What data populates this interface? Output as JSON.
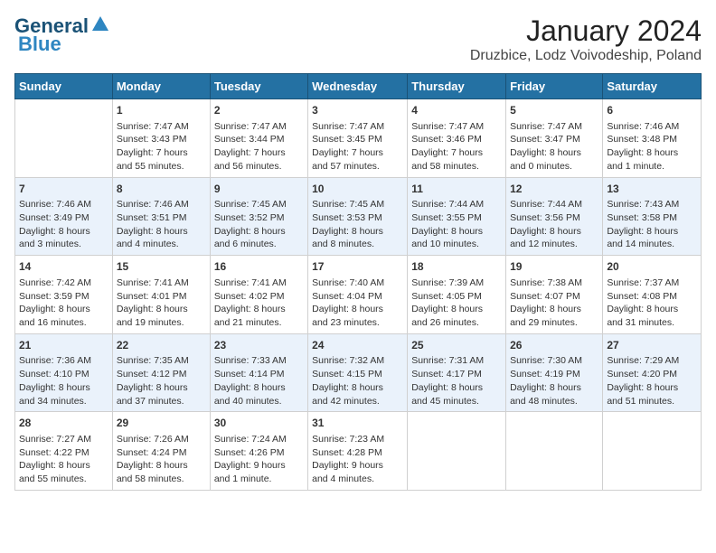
{
  "header": {
    "logo_line1": "General",
    "logo_line2": "Blue",
    "title": "January 2024",
    "subtitle": "Druzbice, Lodz Voivodeship, Poland"
  },
  "weekdays": [
    "Sunday",
    "Monday",
    "Tuesday",
    "Wednesday",
    "Thursday",
    "Friday",
    "Saturday"
  ],
  "weeks": [
    [
      {
        "day": "",
        "info": ""
      },
      {
        "day": "1",
        "info": "Sunrise: 7:47 AM\nSunset: 3:43 PM\nDaylight: 7 hours\nand 55 minutes."
      },
      {
        "day": "2",
        "info": "Sunrise: 7:47 AM\nSunset: 3:44 PM\nDaylight: 7 hours\nand 56 minutes."
      },
      {
        "day": "3",
        "info": "Sunrise: 7:47 AM\nSunset: 3:45 PM\nDaylight: 7 hours\nand 57 minutes."
      },
      {
        "day": "4",
        "info": "Sunrise: 7:47 AM\nSunset: 3:46 PM\nDaylight: 7 hours\nand 58 minutes."
      },
      {
        "day": "5",
        "info": "Sunrise: 7:47 AM\nSunset: 3:47 PM\nDaylight: 8 hours\nand 0 minutes."
      },
      {
        "day": "6",
        "info": "Sunrise: 7:46 AM\nSunset: 3:48 PM\nDaylight: 8 hours\nand 1 minute."
      }
    ],
    [
      {
        "day": "7",
        "info": "Sunrise: 7:46 AM\nSunset: 3:49 PM\nDaylight: 8 hours\nand 3 minutes."
      },
      {
        "day": "8",
        "info": "Sunrise: 7:46 AM\nSunset: 3:51 PM\nDaylight: 8 hours\nand 4 minutes."
      },
      {
        "day": "9",
        "info": "Sunrise: 7:45 AM\nSunset: 3:52 PM\nDaylight: 8 hours\nand 6 minutes."
      },
      {
        "day": "10",
        "info": "Sunrise: 7:45 AM\nSunset: 3:53 PM\nDaylight: 8 hours\nand 8 minutes."
      },
      {
        "day": "11",
        "info": "Sunrise: 7:44 AM\nSunset: 3:55 PM\nDaylight: 8 hours\nand 10 minutes."
      },
      {
        "day": "12",
        "info": "Sunrise: 7:44 AM\nSunset: 3:56 PM\nDaylight: 8 hours\nand 12 minutes."
      },
      {
        "day": "13",
        "info": "Sunrise: 7:43 AM\nSunset: 3:58 PM\nDaylight: 8 hours\nand 14 minutes."
      }
    ],
    [
      {
        "day": "14",
        "info": "Sunrise: 7:42 AM\nSunset: 3:59 PM\nDaylight: 8 hours\nand 16 minutes."
      },
      {
        "day": "15",
        "info": "Sunrise: 7:41 AM\nSunset: 4:01 PM\nDaylight: 8 hours\nand 19 minutes."
      },
      {
        "day": "16",
        "info": "Sunrise: 7:41 AM\nSunset: 4:02 PM\nDaylight: 8 hours\nand 21 minutes."
      },
      {
        "day": "17",
        "info": "Sunrise: 7:40 AM\nSunset: 4:04 PM\nDaylight: 8 hours\nand 23 minutes."
      },
      {
        "day": "18",
        "info": "Sunrise: 7:39 AM\nSunset: 4:05 PM\nDaylight: 8 hours\nand 26 minutes."
      },
      {
        "day": "19",
        "info": "Sunrise: 7:38 AM\nSunset: 4:07 PM\nDaylight: 8 hours\nand 29 minutes."
      },
      {
        "day": "20",
        "info": "Sunrise: 7:37 AM\nSunset: 4:08 PM\nDaylight: 8 hours\nand 31 minutes."
      }
    ],
    [
      {
        "day": "21",
        "info": "Sunrise: 7:36 AM\nSunset: 4:10 PM\nDaylight: 8 hours\nand 34 minutes."
      },
      {
        "day": "22",
        "info": "Sunrise: 7:35 AM\nSunset: 4:12 PM\nDaylight: 8 hours\nand 37 minutes."
      },
      {
        "day": "23",
        "info": "Sunrise: 7:33 AM\nSunset: 4:14 PM\nDaylight: 8 hours\nand 40 minutes."
      },
      {
        "day": "24",
        "info": "Sunrise: 7:32 AM\nSunset: 4:15 PM\nDaylight: 8 hours\nand 42 minutes."
      },
      {
        "day": "25",
        "info": "Sunrise: 7:31 AM\nSunset: 4:17 PM\nDaylight: 8 hours\nand 45 minutes."
      },
      {
        "day": "26",
        "info": "Sunrise: 7:30 AM\nSunset: 4:19 PM\nDaylight: 8 hours\nand 48 minutes."
      },
      {
        "day": "27",
        "info": "Sunrise: 7:29 AM\nSunset: 4:20 PM\nDaylight: 8 hours\nand 51 minutes."
      }
    ],
    [
      {
        "day": "28",
        "info": "Sunrise: 7:27 AM\nSunset: 4:22 PM\nDaylight: 8 hours\nand 55 minutes."
      },
      {
        "day": "29",
        "info": "Sunrise: 7:26 AM\nSunset: 4:24 PM\nDaylight: 8 hours\nand 58 minutes."
      },
      {
        "day": "30",
        "info": "Sunrise: 7:24 AM\nSunset: 4:26 PM\nDaylight: 9 hours\nand 1 minute."
      },
      {
        "day": "31",
        "info": "Sunrise: 7:23 AM\nSunset: 4:28 PM\nDaylight: 9 hours\nand 4 minutes."
      },
      {
        "day": "",
        "info": ""
      },
      {
        "day": "",
        "info": ""
      },
      {
        "day": "",
        "info": ""
      }
    ]
  ]
}
